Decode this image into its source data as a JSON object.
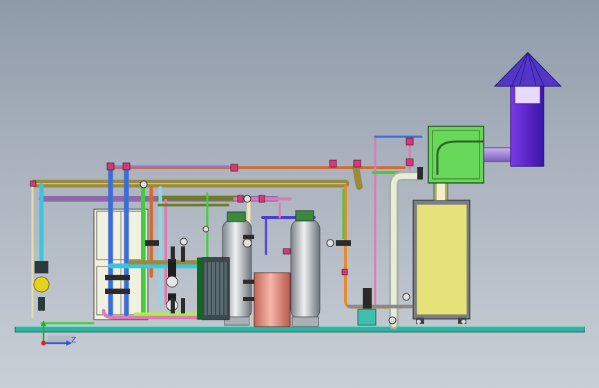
{
  "viewport": {
    "background_top": "#8f9aa9",
    "background_bottom": "#c9cfd6"
  },
  "triad": {
    "axis_label_z": "Z",
    "colors": {
      "x": "#2a56d8",
      "y": "#19b528",
      "origin": "#e0202a"
    }
  },
  "equipment": [
    "skid-base-plate",
    "water-storage-tank",
    "softener-vessel-left",
    "softener-vessel-right",
    "brine-tank",
    "plate-heat-exchanger",
    "boiler-cabinet",
    "flue-box",
    "chimney-cap",
    "pump-left",
    "pump-right",
    "metering-pump",
    "yellow-pump-valve"
  ],
  "colors": {
    "base_plate": "#2db3a0",
    "softener_vessel": "#b9bdc4",
    "brine_tank": "#e78a7c",
    "boiler": "#e6e27a",
    "flue_box": "#68d85a",
    "chimney": "#6e2bd4",
    "pipe_olive": "#9a8a3b",
    "pipe_orange": "#d6692c",
    "pipe_blue": "#3a6dd8",
    "pipe_green": "#3fcf3a",
    "pipe_purple": "#8b6aa6",
    "pipe_cyan": "#38c6e0",
    "pipe_lime": "#aef04a",
    "pipe_pink": "#e07ab6",
    "valve_magenta": "#d23a7a"
  }
}
